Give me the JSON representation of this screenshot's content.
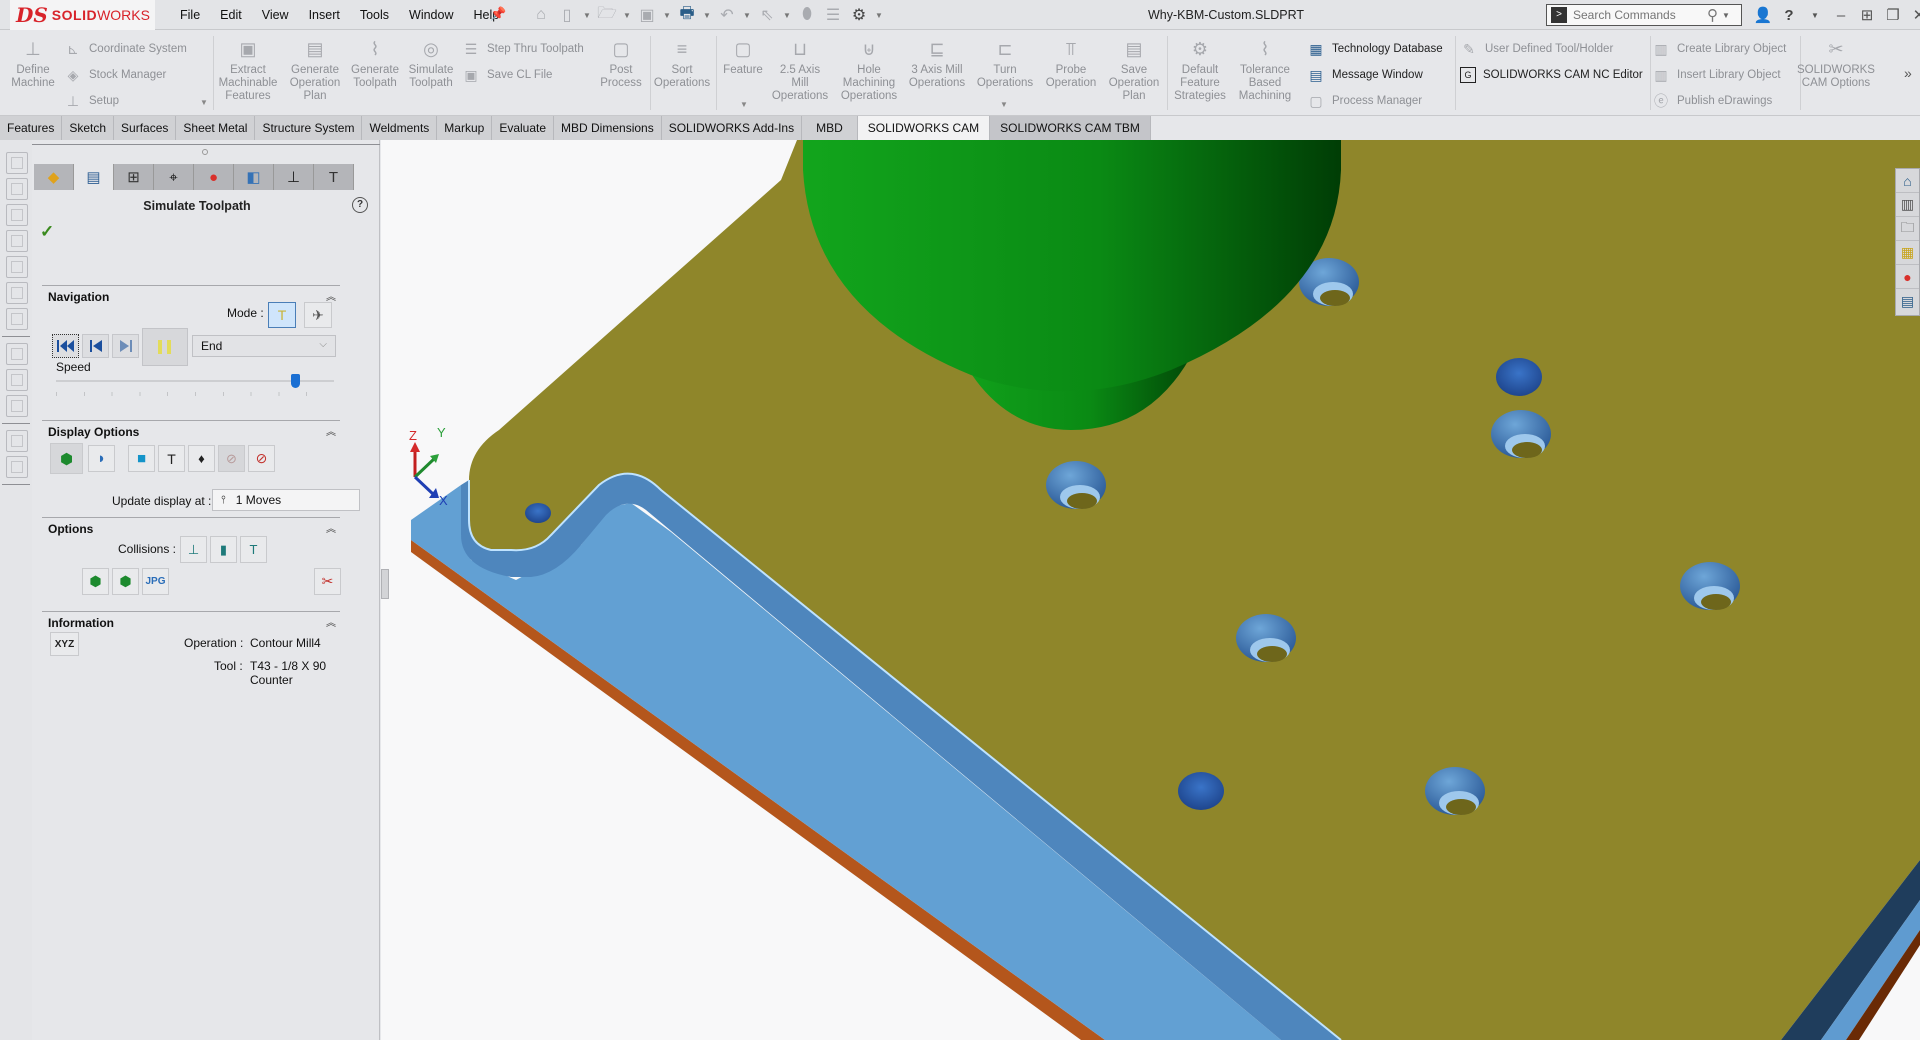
{
  "app": {
    "brand_prefix": "DS",
    "brand_bold": "SOLID",
    "brand_light": "WORKS",
    "document_title": "Why-KBM-Custom.SLDPRT"
  },
  "menu": [
    "File",
    "Edit",
    "View",
    "Insert",
    "Tools",
    "Window",
    "Help"
  ],
  "quick_access": [
    "home-icon",
    "new-document-icon",
    "open-folder-icon",
    "save-icon",
    "print-icon",
    "undo-icon",
    "select-arrow-icon",
    "rebuild-icon",
    "file-properties-icon",
    "options-gear-icon"
  ],
  "search": {
    "placeholder": "Search Commands"
  },
  "window_controls": [
    "user-icon",
    "help-icon",
    "minimize-icon",
    "resize-icon",
    "restore-icon",
    "close-icon"
  ],
  "ribbon": {
    "define_machine": "Define\nMachine",
    "coordinate_system": "Coordinate System",
    "stock_manager": "Stock Manager",
    "setup": "Setup",
    "extract_features": "Extract\nMachinable\nFeatures",
    "generate_op_plan": "Generate\nOperation\nPlan",
    "generate_toolpath": "Generate\nToolpath",
    "simulate_toolpath": "Simulate\nToolpath",
    "step_thru": "Step Thru Toolpath",
    "save_cl": "Save CL File",
    "post_process": "Post\nProcess",
    "sort_operations": "Sort\nOperations",
    "feature": "Feature",
    "mill_25": "2.5 Axis\nMill\nOperations",
    "hole_machining": "Hole\nMachining\nOperations",
    "mill_3axis": "3 Axis Mill\nOperations",
    "turn_operations": "Turn\nOperations",
    "probe_operation": "Probe\nOperation",
    "save_op_plan": "Save\nOperation\nPlan",
    "default_strategies": "Default\nFeature\nStrategies",
    "tolerance_based": "Tolerance\nBased\nMachining",
    "technology_database": "Technology Database",
    "message_window": "Message Window",
    "process_manager": "Process Manager",
    "user_defined_tool": "User Defined Tool/Holder",
    "nc_editor": "SOLIDWORKS CAM NC Editor",
    "create_library": "Create Library Object",
    "insert_library": "Insert Library Object",
    "publish_edrawings": "Publish eDrawings",
    "cam_options": "SOLIDWORKS\nCAM Options",
    "more": "»"
  },
  "command_tabs": [
    {
      "label": "Features",
      "active": false
    },
    {
      "label": "Sketch",
      "active": false
    },
    {
      "label": "Surfaces",
      "active": false
    },
    {
      "label": "Sheet Metal",
      "active": false
    },
    {
      "label": "Structure System",
      "active": false
    },
    {
      "label": "Weldments",
      "active": false
    },
    {
      "label": "Markup",
      "active": false
    },
    {
      "label": "Evaluate",
      "active": false
    },
    {
      "label": "MBD Dimensions",
      "active": false
    },
    {
      "label": "SOLIDWORKS Add-Ins",
      "active": false
    },
    {
      "label": "MBD",
      "active": false
    },
    {
      "label": "SOLIDWORKS CAM",
      "active": true
    },
    {
      "label": "SOLIDWORKS CAM TBM",
      "active": false
    }
  ],
  "property_manager": {
    "tabs": [
      "feature-manager-icon",
      "property-manager-icon",
      "configuration-manager-icon",
      "dimxpert-icon",
      "display-manager-icon",
      "cam-feature-tree-icon",
      "cam-operation-tree-icon",
      "cam-tool-tree-icon"
    ],
    "active_tab": 1,
    "title": "Simulate Toolpath",
    "help": "?",
    "ok": "✓",
    "navigation": {
      "title": "Navigation",
      "mode_label": "Mode :",
      "end_option": "End",
      "speed_label": "Speed",
      "speed_fraction": 0.86
    },
    "display_options": {
      "title": "Display Options",
      "update_label": "Update display at :",
      "update_value": "1 Moves"
    },
    "options": {
      "title": "Options",
      "collisions_label": "Collisions :"
    },
    "information": {
      "title": "Information",
      "xyz": "XYZ",
      "operation_label": "Operation :",
      "operation_value": "Contour Mill4",
      "tool_label": "Tool :",
      "tool_value": "T43 - 1/8 X 90 Counter"
    }
  },
  "triad": {
    "x": "X",
    "y": "Y",
    "z": "Z"
  },
  "colors": {
    "part_top": "#8f862a",
    "part_side": "#5f9bd0",
    "part_bottom": "#b4561c",
    "tool_green": "#10a31a",
    "hole_blue": "#2a5aa8",
    "accent": "#d8232a"
  },
  "task_pane": [
    "resources-home-icon",
    "design-library-icon",
    "file-explorer-icon",
    "view-palette-icon",
    "appearances-icon",
    "custom-properties-icon"
  ]
}
